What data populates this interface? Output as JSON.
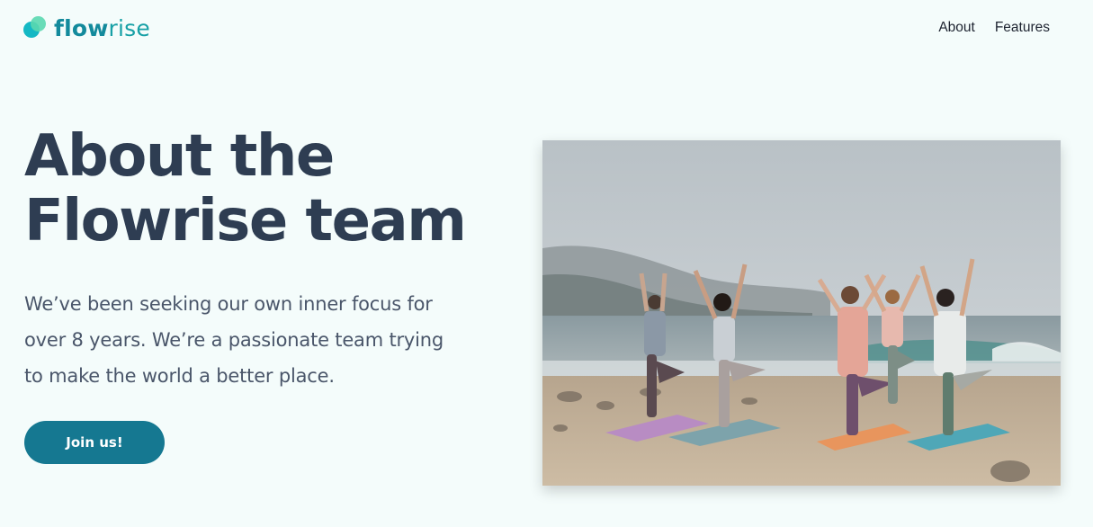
{
  "brand": {
    "name_bold": "flow",
    "name_light": "rise",
    "colors": {
      "primary": "#157891",
      "logo_teal": "#14b8c4",
      "logo_mint": "#5ad8b0",
      "heading": "#2e3d52"
    }
  },
  "nav": {
    "items": [
      {
        "label": "About"
      },
      {
        "label": "Features"
      }
    ]
  },
  "hero": {
    "title_line1": "About the",
    "title_line2": "Flowrise team",
    "description": "We’ve been seeking our own inner focus for over 8 years. We’re a passionate team trying to make the world a better place.",
    "cta_label": "Join us!"
  },
  "image": {
    "subject": "group-yoga-on-beach-photo"
  }
}
